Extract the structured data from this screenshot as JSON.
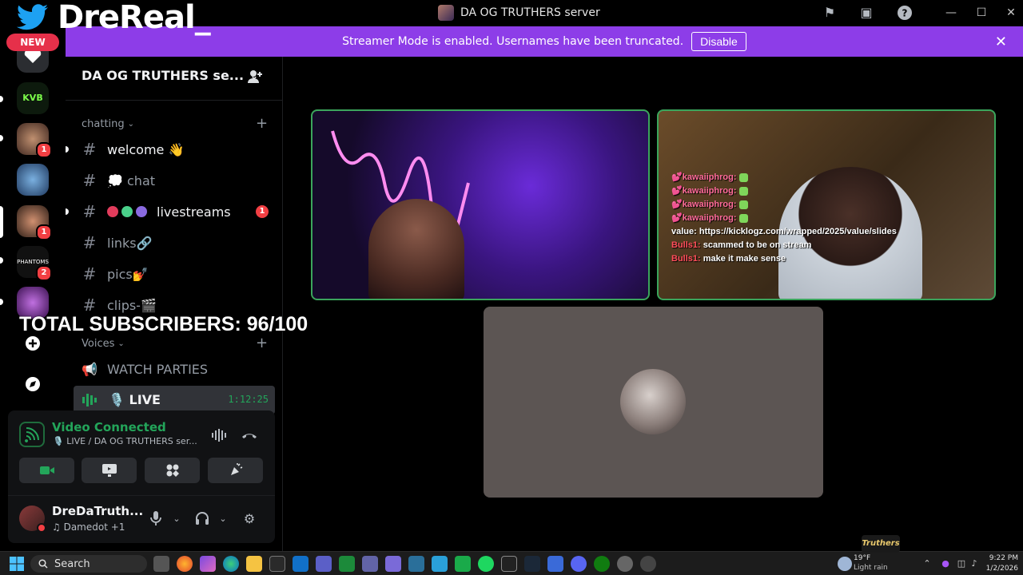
{
  "window": {
    "title": "DA OG TRUTHERS server"
  },
  "overlay": {
    "brand_name": "DreReal_",
    "new_badge": "NEW",
    "subscribers": "TOTAL SUBSCRIBERS: 96/100",
    "corner_logo": "Truthers"
  },
  "banner": {
    "message": "Streamer Mode is enabled. Usernames have been truncated.",
    "disable_label": "Disable"
  },
  "rail": {
    "servers": [
      {
        "name": "server-1",
        "badge": ""
      },
      {
        "name": "KVB",
        "label": "KVB",
        "badge": ""
      },
      {
        "name": "server-3",
        "badge": "1"
      },
      {
        "name": "server-4",
        "badge": ""
      },
      {
        "name": "server-5",
        "badge": "1"
      },
      {
        "name": "PHANTOMS",
        "label": "PHANTOMS",
        "badge": "2"
      },
      {
        "name": "server-7",
        "badge": ""
      }
    ]
  },
  "sidebar": {
    "server_name": "DA OG TRUTHERS se...",
    "categories": {
      "chatting": "chatting",
      "voices": "Voices"
    },
    "channels": [
      {
        "name": "welcome 👋",
        "unread": true,
        "badge": ""
      },
      {
        "name": "💭 chat",
        "unread": false,
        "badge": ""
      },
      {
        "name": "livestreams",
        "unread": true,
        "badge": "1"
      },
      {
        "name": "links🔗",
        "unread": false,
        "badge": ""
      },
      {
        "name": "pics💅",
        "unread": false,
        "badge": ""
      },
      {
        "name": "clips-🎬",
        "unread": false,
        "badge": ""
      }
    ],
    "voice_channels": {
      "watch_parties": "WATCH PARTIES",
      "live_label": "🎙️ LIVE",
      "live_timer": "1:12:25"
    }
  },
  "voice_panel": {
    "status": "Video Connected",
    "location": "🎙️ LIVE / DA OG TRUTHERS ser..."
  },
  "user": {
    "name": "DreDaTruth...",
    "status": "♫ Damedot +1"
  },
  "stream_chat": [
    {
      "user": "💕kawaiiphrog:",
      "msg": "",
      "emote": true,
      "cls": "u1"
    },
    {
      "user": "💕kawaiiphrog:",
      "msg": "",
      "emote": true,
      "cls": "u1"
    },
    {
      "user": "💕kawaiiphrog:",
      "msg": "",
      "emote": true,
      "cls": "u1"
    },
    {
      "user": "💕kawaiiphrog:",
      "msg": "",
      "emote": true,
      "cls": "u1"
    },
    {
      "user": "value:",
      "msg": "https://kicklogz.com/wrapped/2025/value/slides",
      "emote": false,
      "cls": "u2"
    },
    {
      "user": "Bulls1:",
      "msg": "scammed to be on stream",
      "emote": false,
      "cls": "u3"
    },
    {
      "user": "Bulls1:",
      "msg": "make it make sense",
      "emote": false,
      "cls": "u3"
    }
  ],
  "taskbar": {
    "search_label": "Search",
    "weather_temp": "19°F",
    "weather_desc": "Light rain",
    "time": "9:22 PM",
    "date": "1/2/2026"
  },
  "colors": {
    "banner": "#8d3de8",
    "connected": "#23a55a",
    "badge": "#f23f43",
    "speaking_border": "#3ba55c"
  }
}
